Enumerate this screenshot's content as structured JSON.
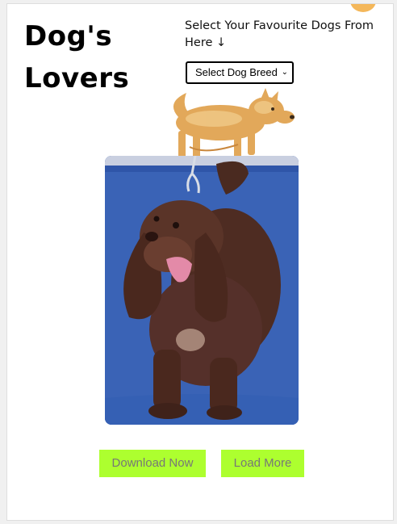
{
  "header": {
    "title": "Dog's Lovers",
    "instruction": "Select Your Favourite Dogs From Here ↓"
  },
  "breed_select": {
    "selected": "Select Dog Breed",
    "chevron": "⌄"
  },
  "actions": {
    "download_label": "Download Now",
    "load_more_label": "Load More"
  },
  "colors": {
    "button_bg": "#adff2f",
    "button_text": "#777777",
    "badge": "#f4b75a",
    "photo_bg": "#3a63b6"
  },
  "images": {
    "top_image": "small-tan-dog-image",
    "main_image": "brown-spaniel-dog-image"
  }
}
